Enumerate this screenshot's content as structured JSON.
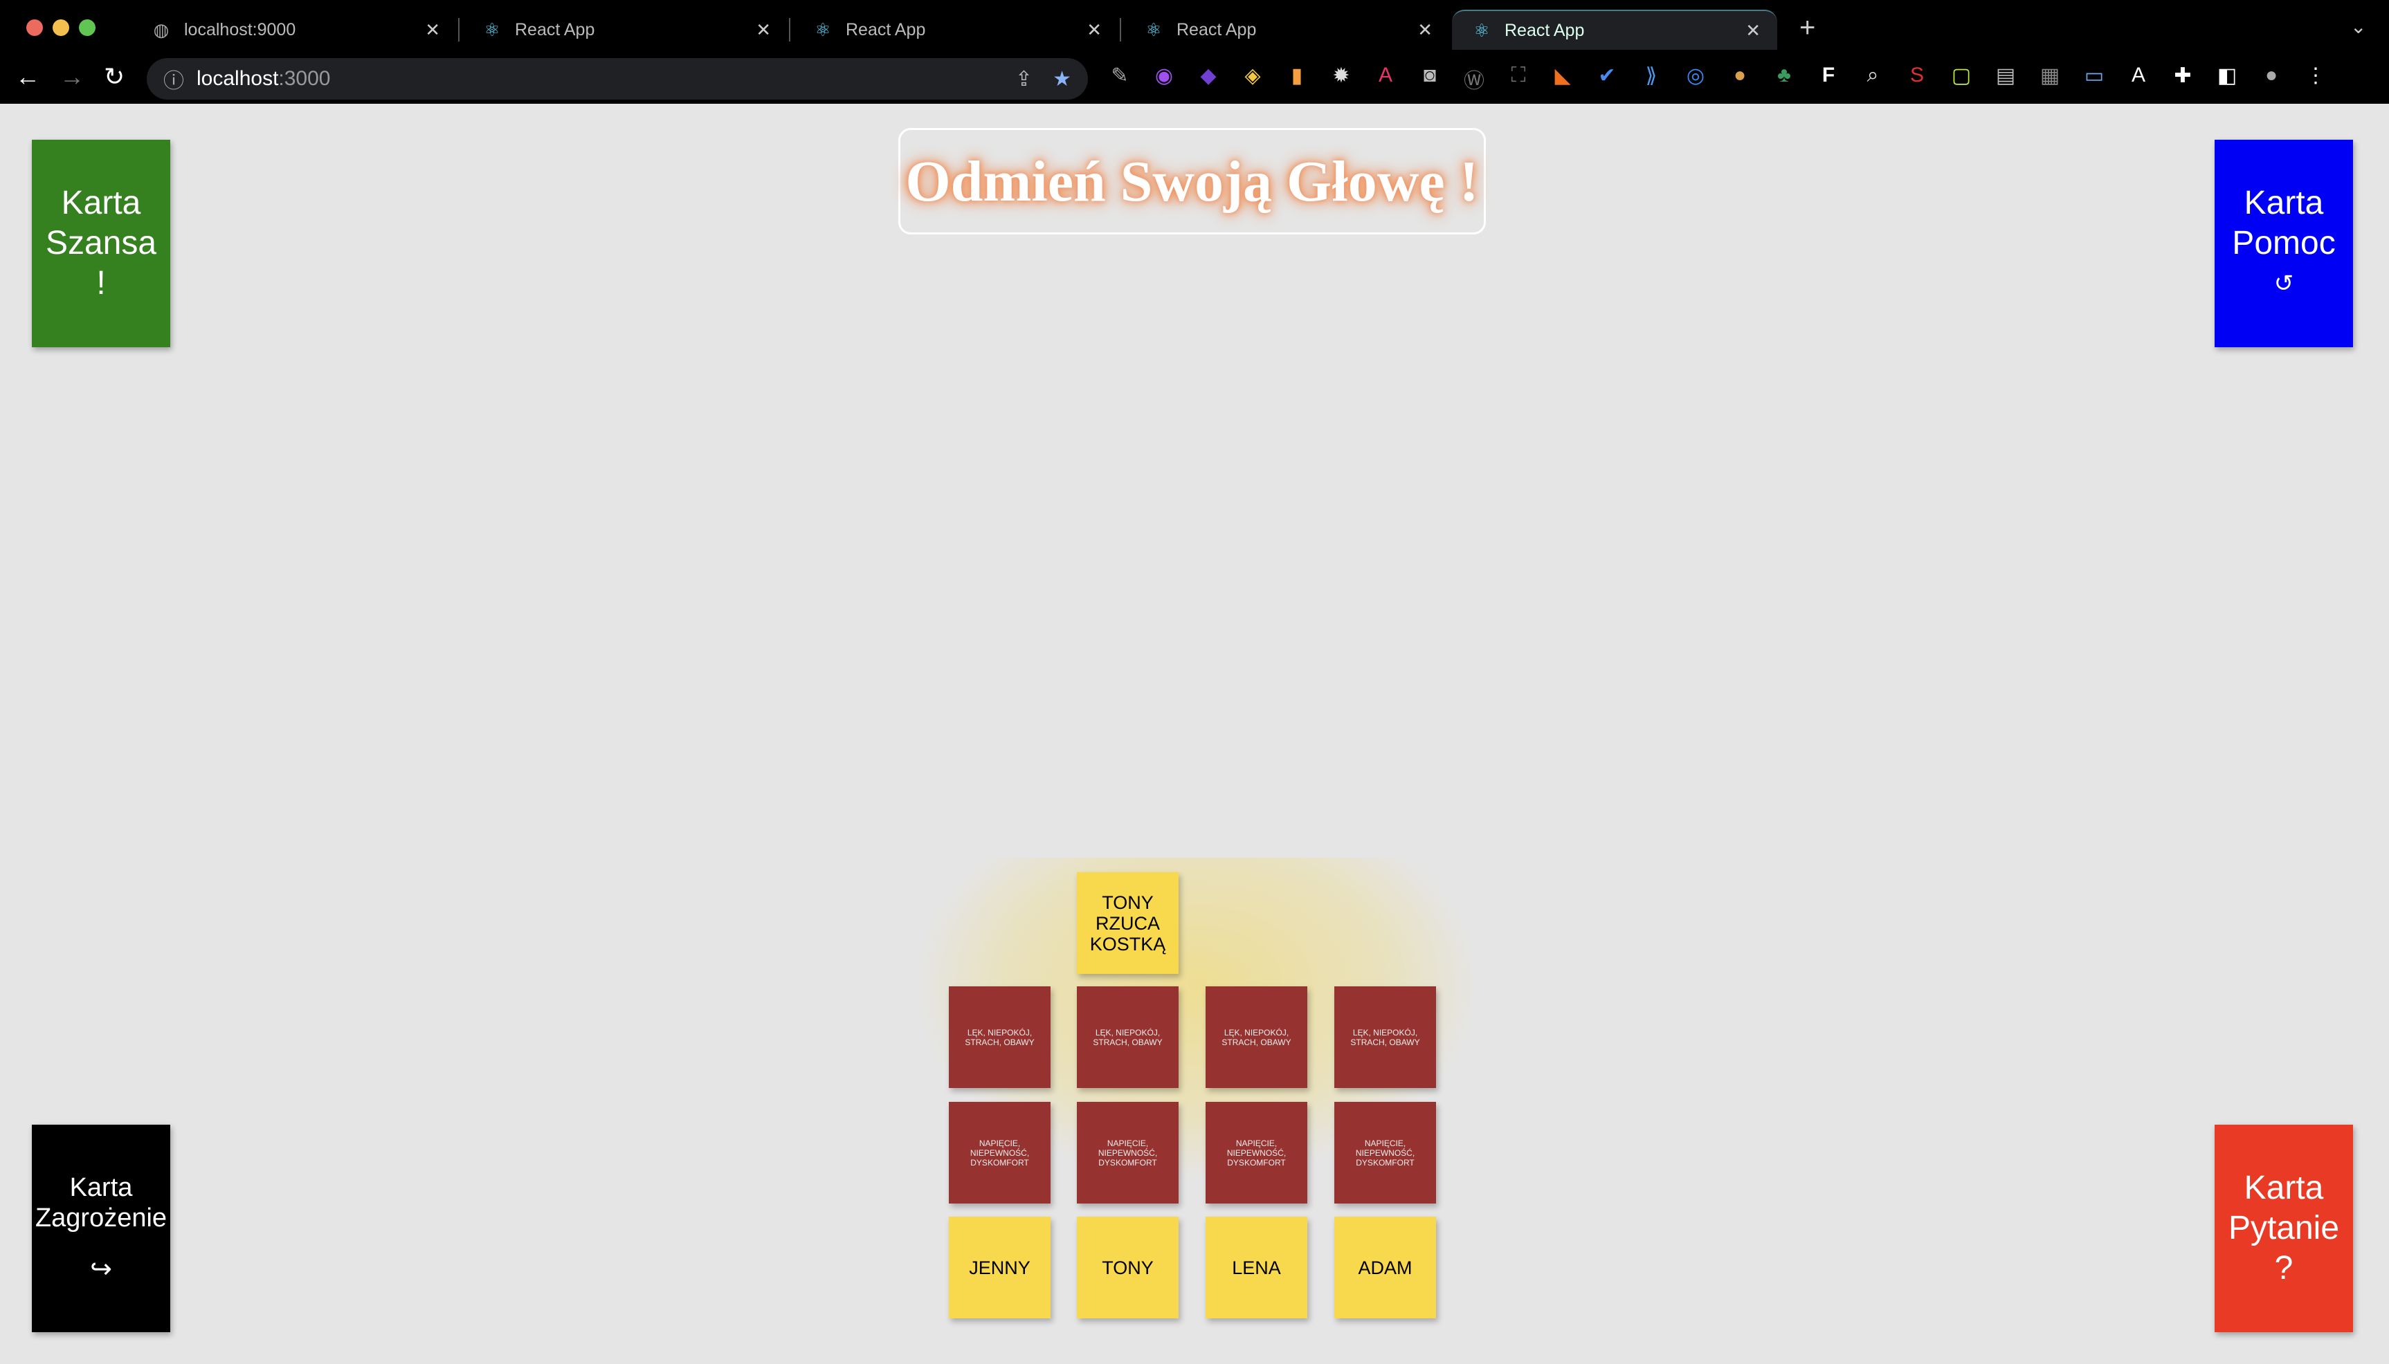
{
  "browser": {
    "tabs": [
      {
        "label": "localhost:9000",
        "icon": "globe-icon"
      },
      {
        "label": "React App",
        "icon": "react-icon"
      },
      {
        "label": "React App",
        "icon": "react-icon"
      },
      {
        "label": "React App",
        "icon": "react-icon"
      },
      {
        "label": "React App",
        "icon": "react-icon",
        "active": true
      }
    ],
    "address_host": "localhost",
    "address_port": ":3000"
  },
  "page": {
    "title": "Odmień Swoją Głowę !",
    "cards": {
      "chance": {
        "line1": "Karta",
        "line2": "Szansa",
        "symbol": "!",
        "color": "#35801f"
      },
      "help": {
        "line1": "Karta",
        "line2": "Pomoc",
        "symbol": "↺",
        "color": "#0000f5"
      },
      "threat": {
        "line1": "Karta",
        "line2": "Zagrożenie",
        "symbol": "↪",
        "color": "#000000"
      },
      "question": {
        "line1": "Karta",
        "line2": "Pytanie",
        "symbol": "?",
        "color": "#e83a24"
      }
    },
    "turn_label": "TONY RZUCA KOSTKĄ",
    "row1": [
      "LĘK, NIEPOKÓJ, STRACH, OBAWY",
      "LĘK, NIEPOKÓJ, STRACH, OBAWY",
      "LĘK, NIEPOKÓJ, STRACH, OBAWY",
      "LĘK, NIEPOKÓJ, STRACH, OBAWY"
    ],
    "row2": [
      "NAPIĘCIE, NIEPEWNOŚĆ, DYSKOMFORT",
      "NAPIĘCIE, NIEPEWNOŚĆ, DYSKOMFORT",
      "NAPIĘCIE, NIEPEWNOŚĆ, DYSKOMFORT",
      "NAPIĘCIE, NIEPEWNOŚĆ, DYSKOMFORT"
    ],
    "players": [
      "JENNY",
      "TONY",
      "LENA",
      "ADAM"
    ]
  }
}
